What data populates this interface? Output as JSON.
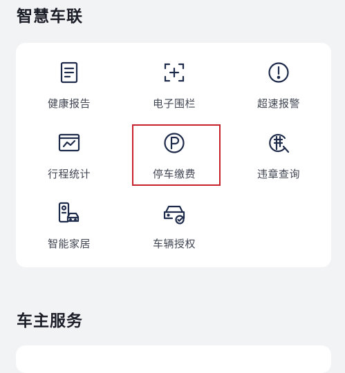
{
  "sections": {
    "smart_car": {
      "title": "智慧车联"
    },
    "owner_service": {
      "title": "车主服务"
    }
  },
  "tiles": [
    {
      "label": "健康报告",
      "icon": "document-icon"
    },
    {
      "label": "电子围栏",
      "icon": "fence-plus-icon"
    },
    {
      "label": "超速报警",
      "icon": "alert-icon"
    },
    {
      "label": "行程统计",
      "icon": "chart-card-icon"
    },
    {
      "label": "停车缴费",
      "icon": "parking-icon"
    },
    {
      "label": "违章查询",
      "icon": "violation-search-icon"
    },
    {
      "label": "智能家居",
      "icon": "smart-home-icon"
    },
    {
      "label": "车辆授权",
      "icon": "car-authorize-icon"
    }
  ],
  "colors": {
    "icon": "#1e2a4a",
    "highlight": "#c8202a"
  }
}
